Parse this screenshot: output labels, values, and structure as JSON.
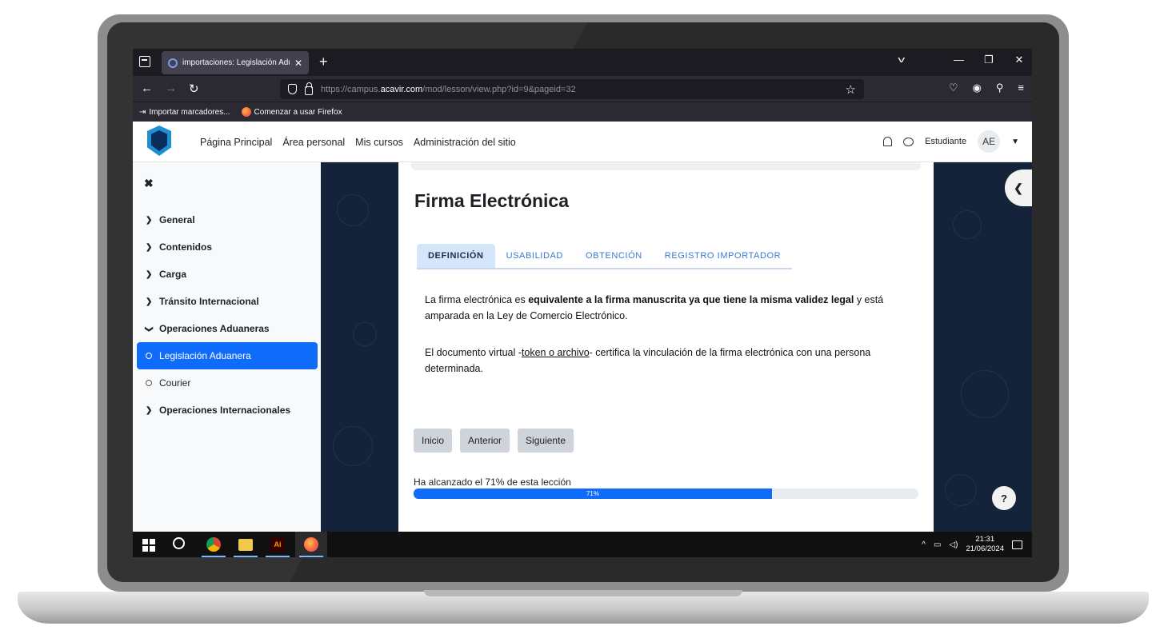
{
  "browser": {
    "tab_title": "importaciones: Legislación Adu",
    "url_prefix": "https://campus.",
    "url_host": "acavir.com",
    "url_path": "/mod/lesson/view.php?id=9&pageid=32",
    "bookmarks": [
      "Importar marcadores...",
      "Comenzar a usar Firefox"
    ]
  },
  "header": {
    "nav": [
      "Página Principal",
      "Área personal",
      "Mis cursos",
      "Administración del sitio"
    ],
    "role": "Estudiante",
    "avatar_initials": "AE"
  },
  "drawer": {
    "items": [
      {
        "label": "General",
        "type": "section",
        "expanded": false
      },
      {
        "label": "Contenidos",
        "type": "section",
        "expanded": false
      },
      {
        "label": "Carga",
        "type": "section",
        "expanded": false
      },
      {
        "label": "Tránsito Internacional",
        "type": "section",
        "expanded": false
      },
      {
        "label": "Operaciones Aduaneras",
        "type": "section",
        "expanded": true
      },
      {
        "label": "Legislación Aduanera",
        "type": "activity",
        "active": true
      },
      {
        "label": "Courier",
        "type": "activity",
        "active": false
      },
      {
        "label": "Operaciones Internacionales",
        "type": "section",
        "expanded": false
      }
    ]
  },
  "lesson": {
    "title": "Firma Electrónica",
    "tabs": [
      "DEFINICIÓN",
      "USABILIDAD",
      "OBTENCIÓN",
      "REGISTRO IMPORTADOR"
    ],
    "active_tab": 0,
    "p1_a": "La firma electrónica es ",
    "p1_b": "equivalente a la firma manuscrita ya que tiene la misma validez legal",
    "p1_c": " y está amparada en la Ley de Comercio Electrónico.",
    "p2_a": "El documento virtual -",
    "p2_b": "token o archivo",
    "p2_c": "- certifica la vinculación de la firma electrónica con una persona determinada.",
    "buttons": [
      "Inicio",
      "Anterior",
      "Siguiente"
    ],
    "progress_label": "Ha alcanzado el 71% de esta lección",
    "progress_percent": 71,
    "progress_text": "71%"
  },
  "taskbar": {
    "time": "21:31",
    "date": "21/06/2024"
  },
  "colors": {
    "primary": "#0f6cfb",
    "page_background": "#15233a",
    "tab_active_bg": "#d6e6fa"
  }
}
